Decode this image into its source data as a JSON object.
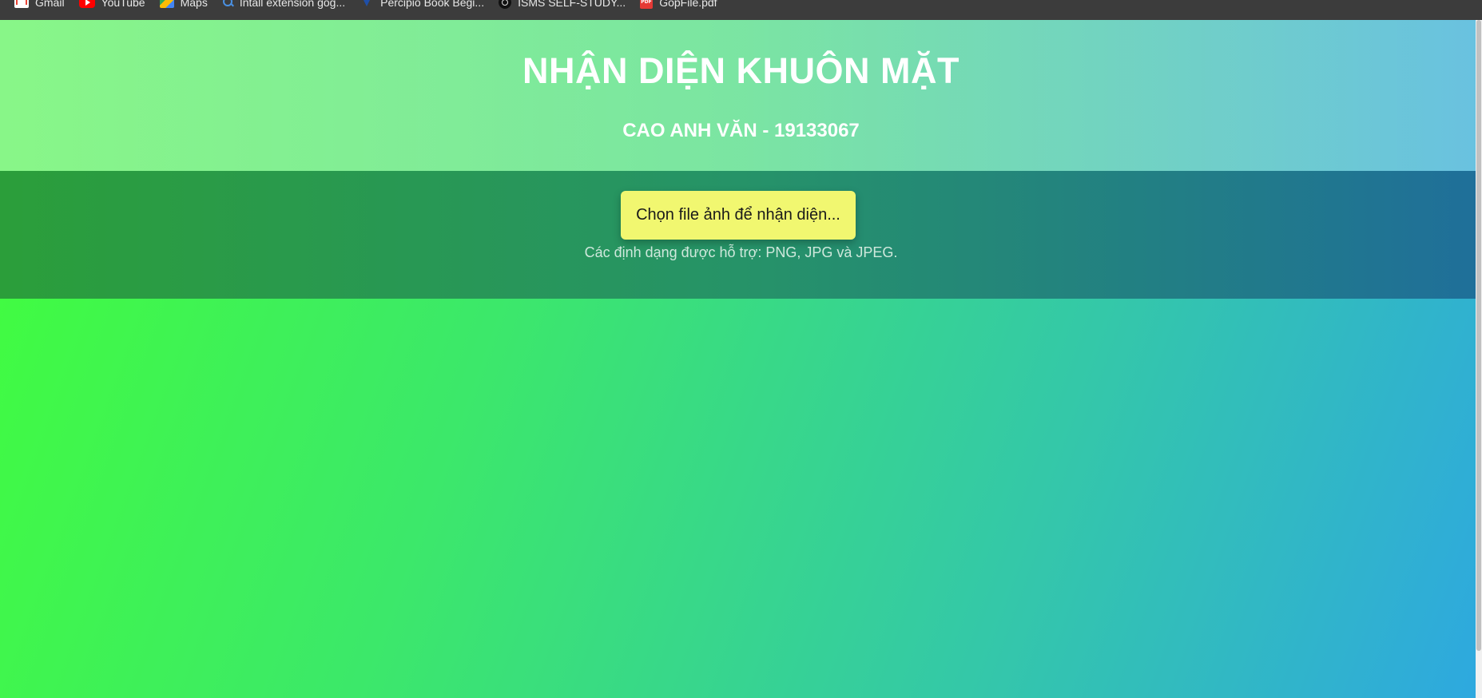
{
  "bookmarks": [
    {
      "label": "Gmail",
      "icon": "gmail-icon"
    },
    {
      "label": "YouTube",
      "icon": "youtube-icon"
    },
    {
      "label": "Maps",
      "icon": "maps-icon"
    },
    {
      "label": "Intall extension gog...",
      "icon": "search-icon"
    },
    {
      "label": "Percipio Book Begi...",
      "icon": "percipio-icon"
    },
    {
      "label": "ISMS SELF-STUDY...",
      "icon": "isms-icon"
    },
    {
      "label": "GopFile.pdf",
      "icon": "pdf-icon"
    }
  ],
  "header": {
    "title": "NHẬN DIỆN KHUÔN MẶT",
    "subtitle": "CAO ANH VĂN - 19133067"
  },
  "upload": {
    "button_label": "Chọn file ảnh để nhận diện...",
    "formats_note": "Các định dạng được hỗ trợ: PNG, JPG và JPEG."
  },
  "colors": {
    "button_bg": "#f1f770",
    "gradient_start": "#42ff3a",
    "gradient_end": "#2ea8e0"
  }
}
